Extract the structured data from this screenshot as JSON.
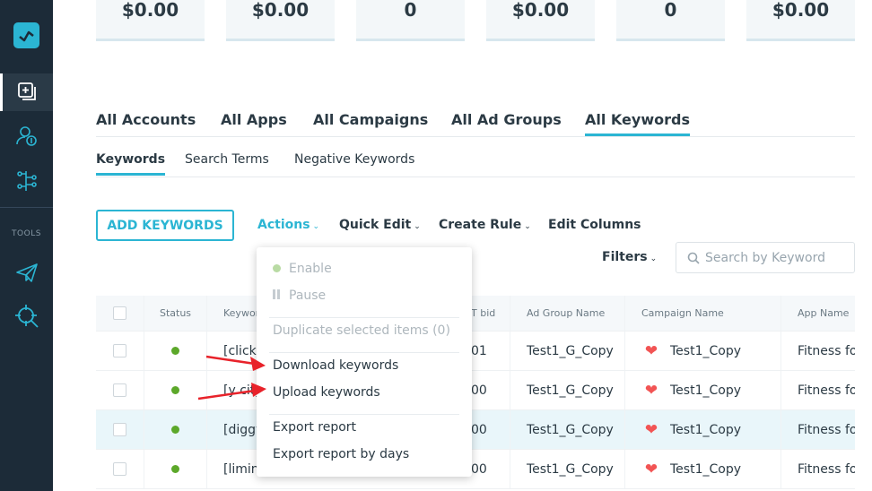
{
  "sidebar": {
    "tools_label": "TOOLS",
    "icons": [
      "logo-icon",
      "add-layers-icon",
      "user-money-icon",
      "flow-icon",
      "send-icon",
      "target-search-icon"
    ],
    "accent": "#2bb5d3"
  },
  "cards": [
    "$0.00",
    "$0.00",
    "0",
    "$0.00",
    "0",
    "$0.00"
  ],
  "level_tabs": [
    {
      "label": "All Accounts"
    },
    {
      "label": "All Apps"
    },
    {
      "label": "All Campaigns"
    },
    {
      "label": "All Ad Groups"
    },
    {
      "label": "All Keywords",
      "active": true
    }
  ],
  "sub_tabs": [
    {
      "label": "Keywords",
      "active": true
    },
    {
      "label": "Search Terms"
    },
    {
      "label": "Negative Keywords"
    }
  ],
  "toolbar": {
    "add_keywords": "ADD KEYWORDS",
    "actions": "Actions",
    "quick_edit": "Quick Edit",
    "create_rule": "Create Rule",
    "edit_columns": "Edit Columns",
    "filters": "Filters",
    "search_placeholder": "Search by Keyword"
  },
  "table": {
    "headers": [
      "Status",
      "Keywor",
      "T bid",
      "Ad Group Name",
      "Campaign Name",
      "App Name"
    ],
    "rows": [
      {
        "keyword": "[click",
        "bid": "01",
        "ad_group": "Test1_G_Copy",
        "campaign": "Test1_Copy",
        "app": "Fitness for"
      },
      {
        "keyword": "[y city",
        "bid": "00",
        "ad_group": "Test1_G_Copy",
        "campaign": "Test1_Copy",
        "app": "Fitness for"
      },
      {
        "keyword": "[diggy",
        "bid": "00",
        "ad_group": "Test1_G_Copy",
        "campaign": "Test1_Copy",
        "app": "Fitness for",
        "highlighted": true
      },
      {
        "keyword": "[limin",
        "bid": "00",
        "ad_group": "Test1_G_Copy",
        "campaign": "Test1_Copy",
        "app": "Fitness for"
      }
    ]
  },
  "actions_menu": {
    "enable": "Enable",
    "pause": "Pause",
    "duplicate": "Duplicate selected items (0)",
    "download": "Download keywords",
    "upload": "Upload keywords",
    "export": "Export report",
    "export_days": "Export report by days"
  },
  "annotation_color": "#e8222a"
}
